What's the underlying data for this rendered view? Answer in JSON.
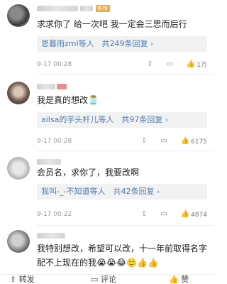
{
  "comments": [
    {
      "username_visible": "·",
      "badge": "铁粉",
      "text": "求求你了 给一次吧 我一定会三思而后行",
      "reply_names": "思暮雨zml等人",
      "reply_total": "共249条回复",
      "date": "9-17 00:28",
      "likes": "1万"
    },
    {
      "text": "我是真的想改🫙",
      "reply_names": "ailsa的芋头杆儿等人",
      "reply_total": "共97条回复",
      "date": "9-17 00:28",
      "likes": "6175"
    },
    {
      "text": "会员名，求你了，我要改啊",
      "reply_names": "我叫-_-不知道等人",
      "reply_total": "共42条回复",
      "date": "9-17 00:22",
      "likes": "4874"
    },
    {
      "text": "我特别想改，希望可以改，十一年前取得名字配不上现在的我😭😭😂🙂👍👍"
    }
  ],
  "bottombar": {
    "repost": "转发",
    "comment": "评论",
    "like": "赞"
  },
  "icons": {
    "share": "share-icon",
    "comment": "comment-icon",
    "like": "thumb-up-icon"
  }
}
